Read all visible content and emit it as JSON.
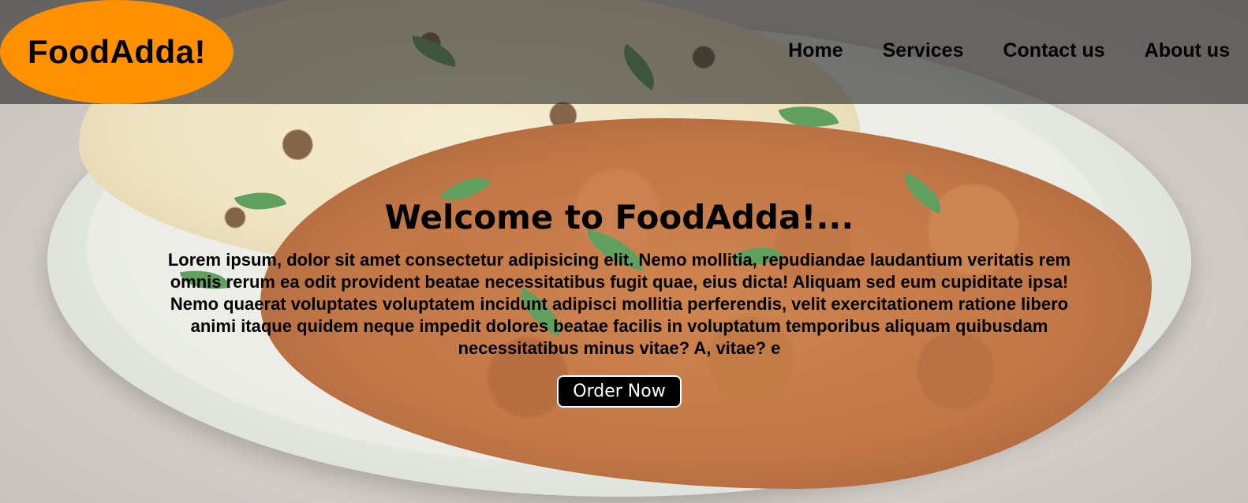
{
  "brand": {
    "logo_text": "FoodAdda!",
    "logo_color": "#ff9100"
  },
  "nav": {
    "items": [
      {
        "label": "Home"
      },
      {
        "label": "Services"
      },
      {
        "label": "Contact us"
      },
      {
        "label": "About us"
      }
    ]
  },
  "hero": {
    "title": "Welcome to FoodAdda!...",
    "description": "Lorem ipsum, dolor sit amet consectetur adipisicing elit. Nemo mollitia, repudiandae laudantium veritatis rem omnis rerum ea odit provident beatae necessitatibus fugit quae, eius dicta! Aliquam sed eum cupiditate ipsa! Nemo quaerat voluptates voluptatem incidunt adipisci mollitia perferendis, velit exercitationem ratione libero animi itaque quidem neque impedit dolores beatae facilis in voluptatum temporibus aliquam quibusdam necessitatibus minus vitae? A, vitae? e",
    "cta_label": "Order Now"
  },
  "colors": {
    "header_overlay": "#282828",
    "button_bg": "#000000",
    "button_text": "#ffffff"
  }
}
